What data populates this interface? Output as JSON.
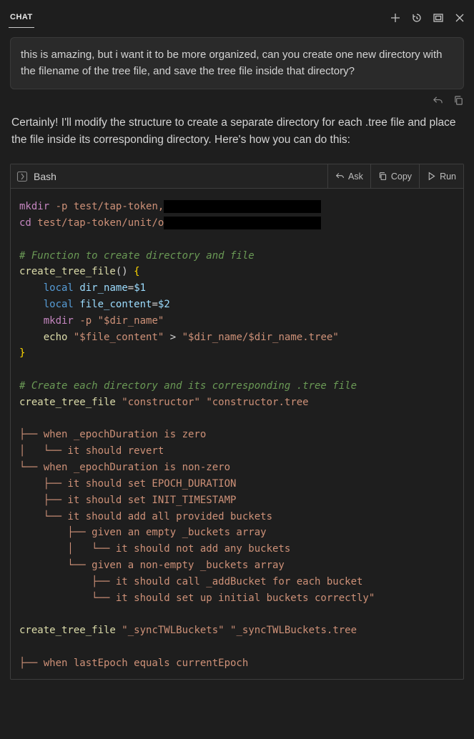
{
  "header": {
    "tab": "CHAT"
  },
  "user_message": "this is amazing, but i want it to be more organized, can you create one new directory with the filename of the tree file, and save the tree file inside that directory?",
  "assistant_message": "Certainly! I'll modify the structure to create a separate directory for each .tree file and place the file inside its corresponding directory. Here's how you can do this:",
  "code": {
    "language": "Bash",
    "actions": {
      "ask": "Ask",
      "copy": "Copy",
      "run": "Run"
    },
    "lines": {
      "mkdir_cmd": "mkdir",
      "mkdir_flag": "-p",
      "mkdir_arg": "test/tap-token,",
      "cd_cmd": "cd",
      "cd_arg": "test/tap-token/unit/o",
      "comment_fn": "# Function to create directory and file",
      "fn_name": "create_tree_file",
      "local1_kw": "local",
      "local1_var": "dir_name",
      "local1_val": "$1",
      "local2_kw": "local",
      "local2_var": "file_content",
      "local2_val": "$2",
      "mkdir2_cmd": "mkdir",
      "mkdir2_flag": "-p",
      "mkdir2_arg": "\"$dir_name\"",
      "echo_cmd": "echo",
      "echo_arg1": "\"$file_content\"",
      "echo_redir": ">",
      "echo_arg2": "\"$dir_name/$dir_name.tree\"",
      "comment_create": "# Create each directory and its corresponding .tree file",
      "call1_fn": "create_tree_file",
      "call1_arg1": "\"constructor\"",
      "call1_arg2": "\"constructor.tree",
      "tree1_l1": "├── when _epochDuration is zero",
      "tree1_l2": "│   └── it should revert",
      "tree1_l3": "└── when _epochDuration is non-zero",
      "tree1_l4": "    ├── it should set EPOCH_DURATION",
      "tree1_l5": "    ├── it should set INIT_TIMESTAMP",
      "tree1_l6": "    └── it should add all provided buckets",
      "tree1_l7": "        ├── given an empty _buckets array",
      "tree1_l8": "        │   └── it should not add any buckets",
      "tree1_l9": "        └── given a non-empty _buckets array",
      "tree1_l10": "            ├── it should call _addBucket for each bucket",
      "tree1_l11": "            └── it should set up initial buckets correctly\"",
      "call2_fn": "create_tree_file",
      "call2_arg1": "\"_syncTWLBuckets\"",
      "call2_arg2": "\"_syncTWLBuckets.tree",
      "tree2_l1": "├── when lastEpoch equals currentEpoch"
    }
  }
}
